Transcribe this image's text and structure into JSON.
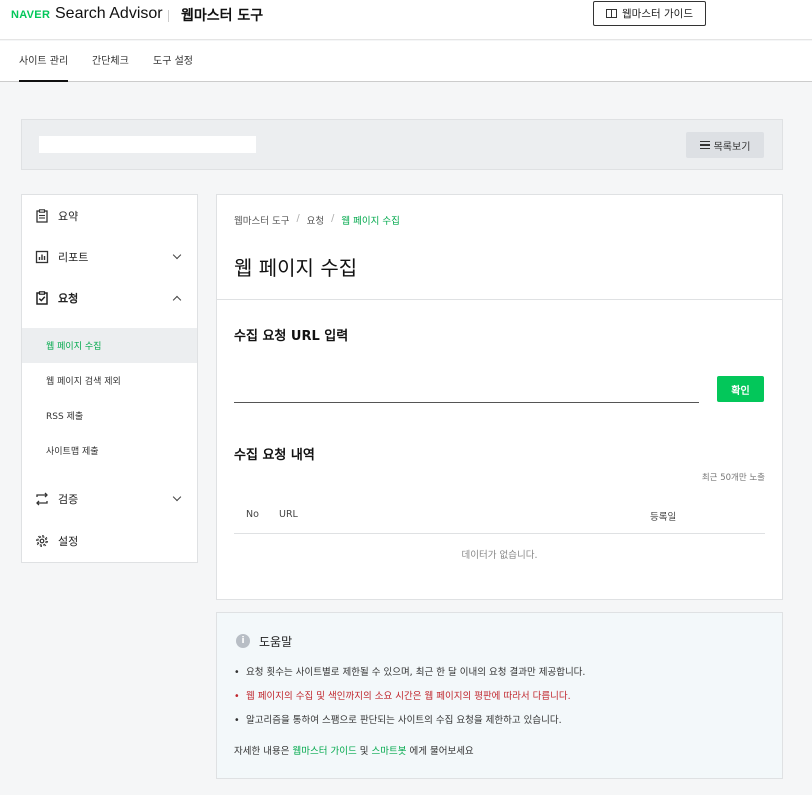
{
  "header": {
    "brand": "NAVER",
    "product": "Search Advisor",
    "tool_title": "웹마스터 도구",
    "guide_button": "웹마스터 가이드"
  },
  "tabs": [
    {
      "label": "사이트 관리",
      "active": true
    },
    {
      "label": "간단체크",
      "active": false
    },
    {
      "label": "도구 설정",
      "active": false
    }
  ],
  "sitebar": {
    "list_button": "목록보기"
  },
  "sidebar": {
    "items": [
      {
        "label": "요약",
        "icon": "clipboard-icon"
      },
      {
        "label": "리포트",
        "icon": "chart-icon",
        "expanded": false
      },
      {
        "label": "요청",
        "icon": "checklist-icon",
        "expanded": true
      },
      {
        "label": "검증",
        "icon": "swap-arrows-icon",
        "expanded": false
      },
      {
        "label": "설정",
        "icon": "gear-icon"
      }
    ],
    "sub_items": [
      {
        "label": "웹 페이지 수집",
        "active": true
      },
      {
        "label": "웹 페이지 검색 제외",
        "active": false
      },
      {
        "label": "RSS 제출",
        "active": false
      },
      {
        "label": "사이트맵 제출",
        "active": false
      }
    ]
  },
  "main": {
    "breadcrumb": [
      "웹마스터 도구",
      "요청",
      "웹 페이지 수집"
    ],
    "title": "웹 페이지 수집",
    "url_section_title": "수집 요청 URL 입력",
    "url_input_value": "",
    "confirm_button": "확인",
    "history_title": "수집 요청 내역",
    "recent_note": "최근 50개만 노출",
    "columns": [
      "No",
      "URL",
      "등록일"
    ],
    "empty_message": "데이터가 없습니다."
  },
  "help": {
    "title": "도움말",
    "items": [
      "요청 횟수는 사이트별로 제한될 수 있으며, 최근 한 달 이내의 요청 결과만 제공합니다.",
      "웹 페이지의 수집 및 색인까지의 소요 시간은 웹 페이지의 평판에 따라서 다릅니다.",
      "알고리즘을 통하여 스팸으로 판단되는 사이트의 수집 요청을 제한하고 있습니다."
    ],
    "foot_prefix": "자세한 내용은",
    "foot_link1": "웹마스터 가이드",
    "foot_mid": "및",
    "foot_link2": "스마트봇",
    "foot_suffix": "에게 물어보세요"
  },
  "colors": {
    "brand_green": "#03c75a",
    "warning_red": "#c0262d"
  }
}
